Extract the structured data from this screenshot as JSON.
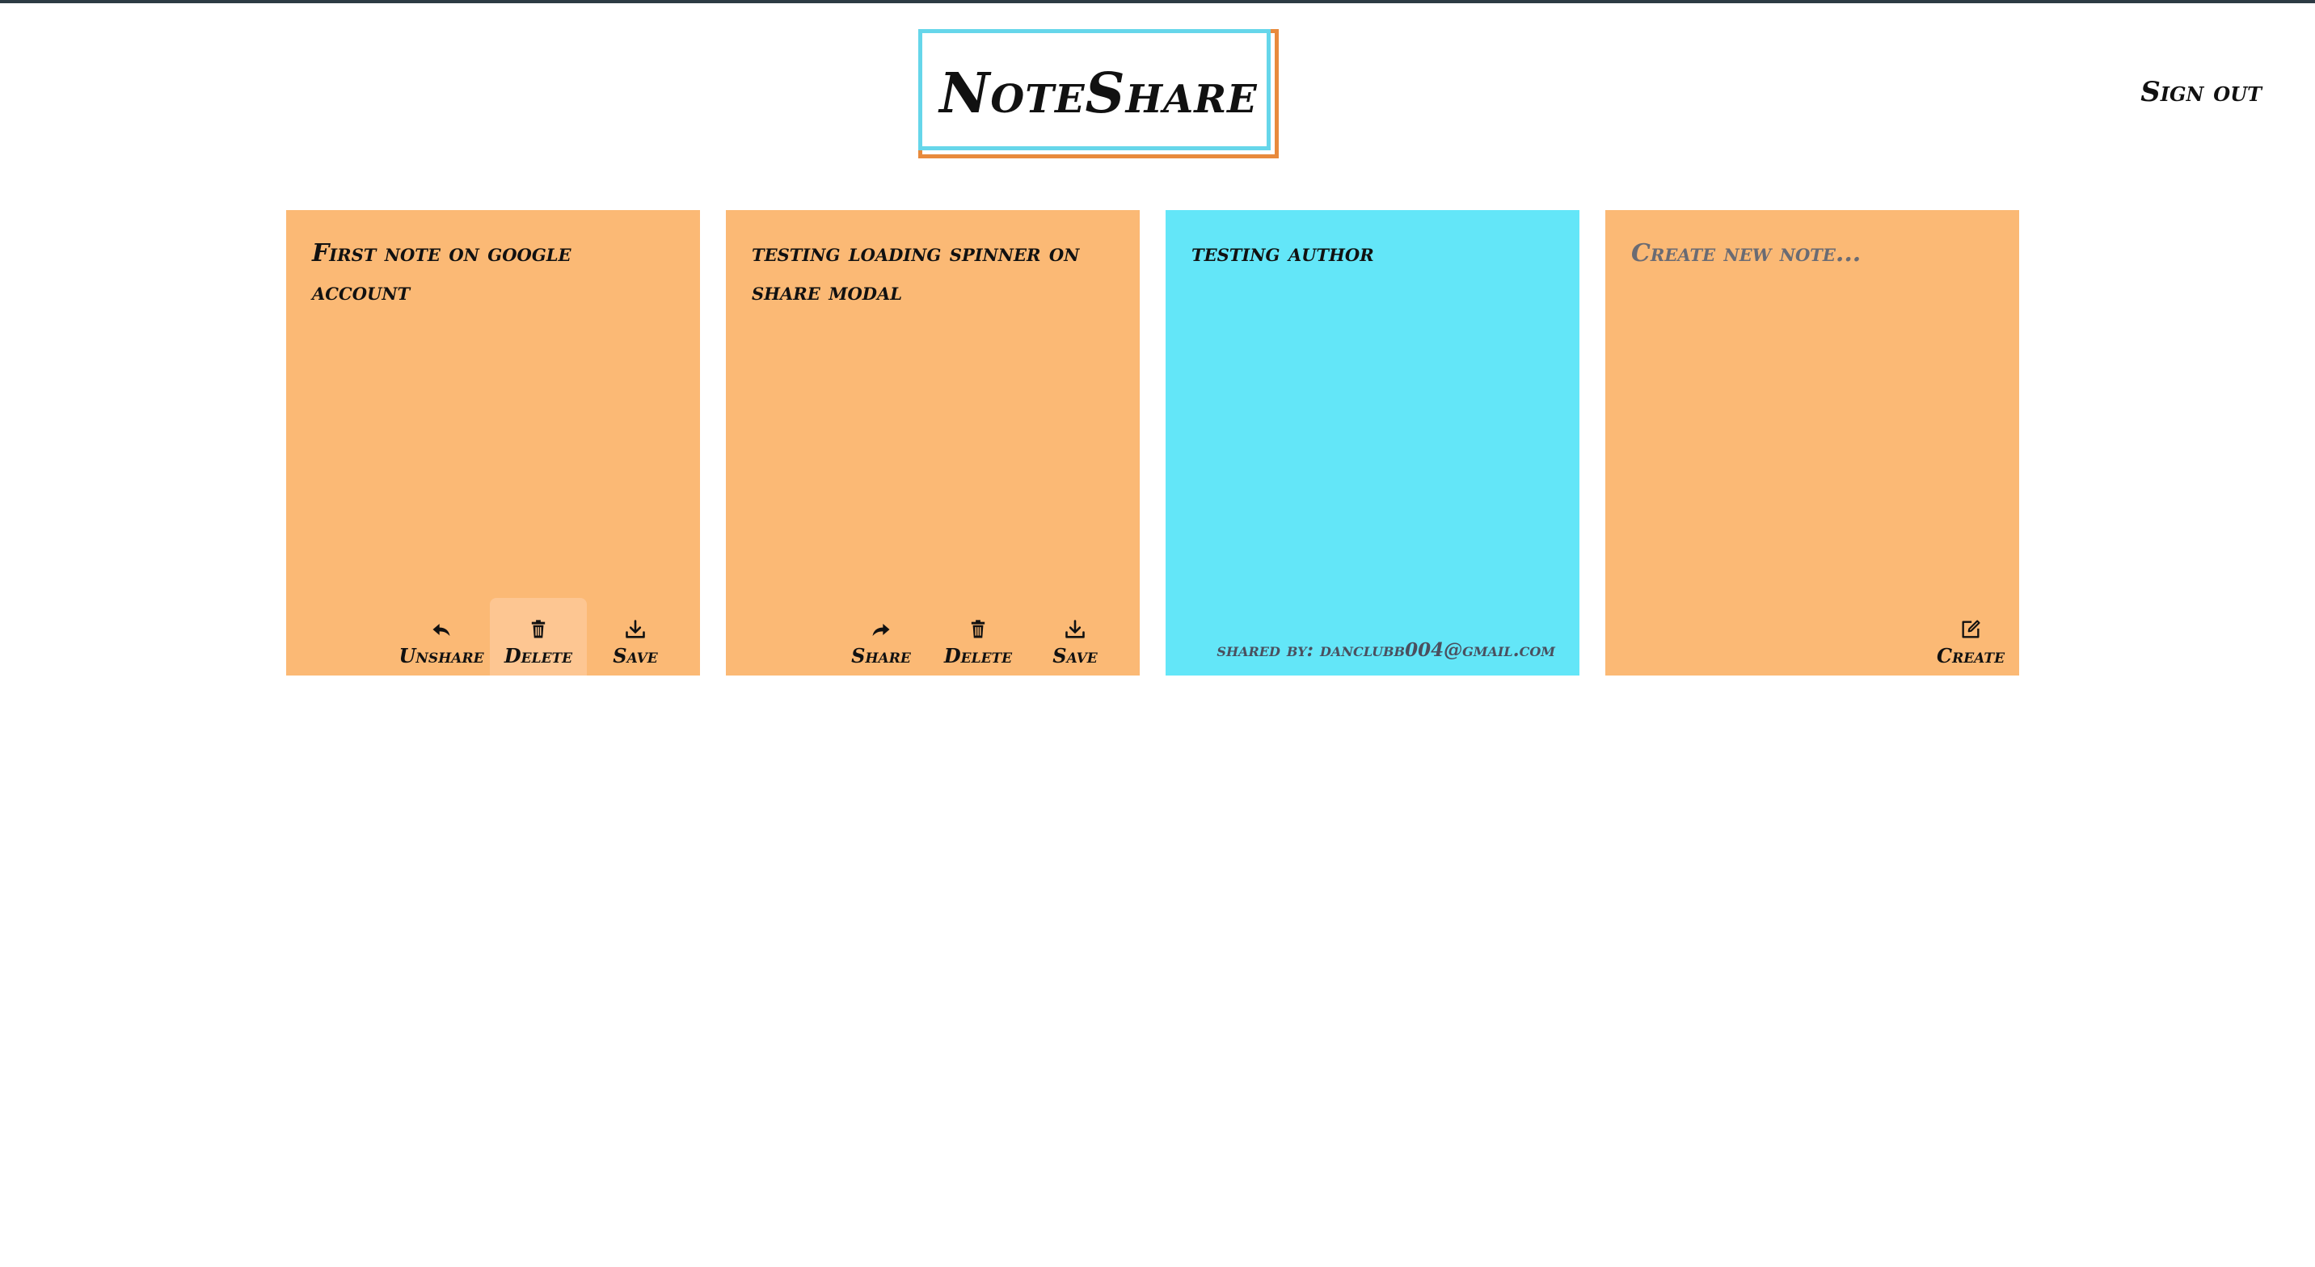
{
  "app": {
    "title": "NoteShare",
    "sign_out_label": "Sign out"
  },
  "notes": [
    {
      "title": "First note on google account",
      "color": "#fbb975",
      "actions": [
        {
          "label": "Unshare",
          "icon": "reply-arrow-icon"
        },
        {
          "label": "Delete",
          "icon": "trash-icon"
        },
        {
          "label": "Save",
          "icon": "download-icon"
        }
      ]
    },
    {
      "title": "testing loading spinner on share modal",
      "color": "#fbb975",
      "actions": [
        {
          "label": "Share",
          "icon": "share-arrow-icon"
        },
        {
          "label": "Delete",
          "icon": "trash-icon"
        },
        {
          "label": "Save",
          "icon": "download-icon"
        }
      ]
    },
    {
      "title": "testing author",
      "color": "#63e6f8",
      "shared_by": "shared by: danclubb004@gmail.com"
    }
  ],
  "new_note": {
    "placeholder": "Create new note...",
    "color": "#fbb975",
    "create_label": "Create",
    "create_icon": "edit-square-icon"
  },
  "colors": {
    "accent_orange": "#e88a3c",
    "accent_cyan": "#66d6ea"
  }
}
